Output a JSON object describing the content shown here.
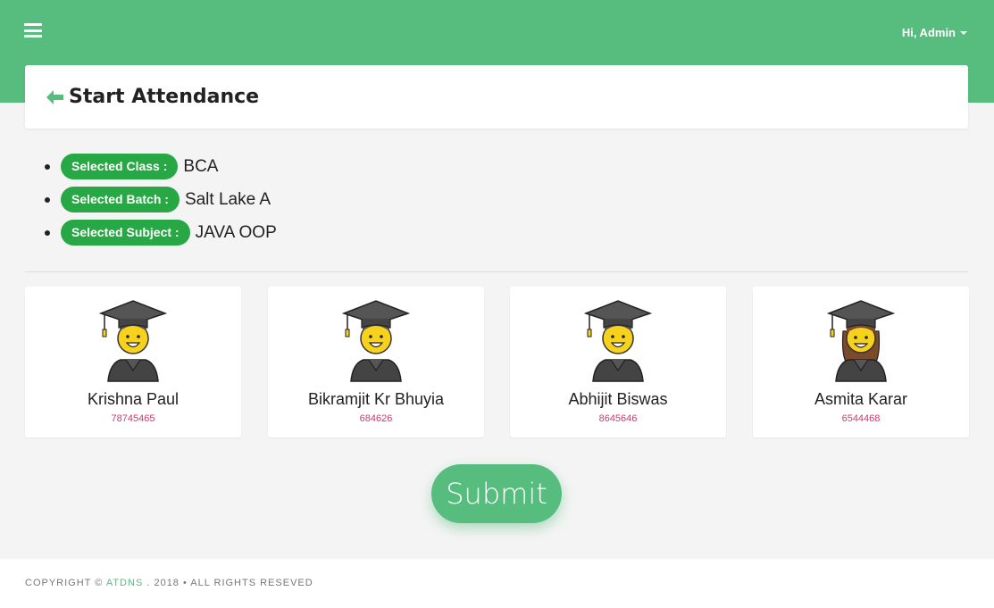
{
  "header": {
    "user_label": "Hi, Admin"
  },
  "page": {
    "title": "Start Attendance"
  },
  "selections": [
    {
      "label": "Selected Class :",
      "value": "BCA"
    },
    {
      "label": "Selected Batch :",
      "value": "Salt Lake A"
    },
    {
      "label": "Selected Subject :",
      "value": "JAVA OOP"
    }
  ],
  "students": [
    {
      "name": "Krishna Paul",
      "id": "78745465",
      "avatar": "male-student-icon"
    },
    {
      "name": "Bikramjit Kr Bhuyia",
      "id": "684626",
      "avatar": "male-student-icon"
    },
    {
      "name": "Abhijit Biswas",
      "id": "8645646",
      "avatar": "male-student-icon"
    },
    {
      "name": "Asmita Karar",
      "id": "6544468",
      "avatar": "female-student-icon"
    }
  ],
  "actions": {
    "submit_label": "Submit"
  },
  "footer": {
    "copyright_prefix": "COPYRIGHT ©",
    "brand": "ATDNS",
    "copyright_suffix": ". 2018  •  ALL RIGHTS RESEVED"
  },
  "colors": {
    "primary": "#57bd7f",
    "badge": "#28a745",
    "id_text": "#e0306b"
  }
}
